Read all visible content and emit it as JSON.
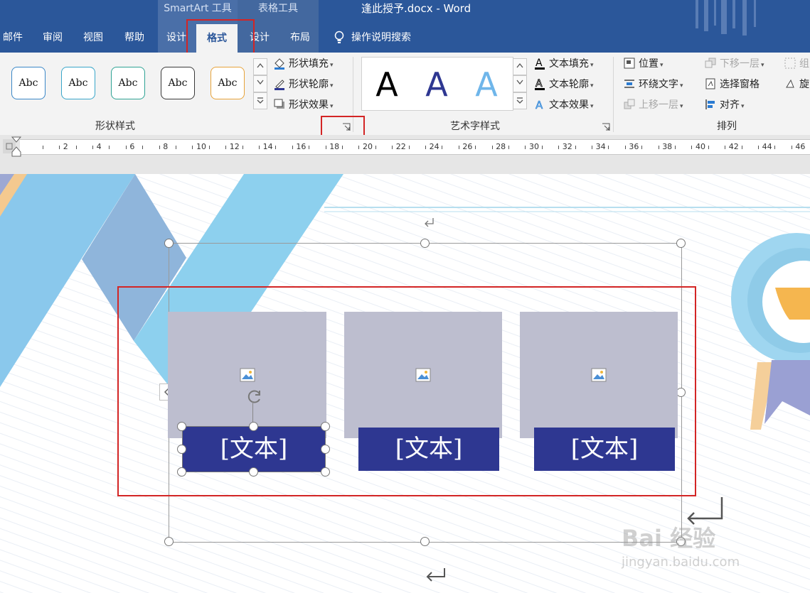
{
  "window": {
    "title": "逢此授予.docx  -  Word",
    "context_groups": [
      "SmartArt 工具",
      "表格工具"
    ]
  },
  "tabs": [
    {
      "label": "邮件"
    },
    {
      "label": "审阅"
    },
    {
      "label": "视图"
    },
    {
      "label": "帮助"
    },
    {
      "label": "设计"
    },
    {
      "label": "格式",
      "active": true
    },
    {
      "label": "设计"
    },
    {
      "label": "布局"
    }
  ],
  "tell_me": "操作说明搜索",
  "ribbon": {
    "shape_styles": {
      "presets": [
        "Abc",
        "Abc",
        "Abc",
        "Abc",
        "Abc"
      ],
      "preset_colors": [
        "#3a87c7",
        "#39a6c9",
        "#2fa394",
        "#3a3a3a",
        "#e7a33a"
      ],
      "fill": "形状填充",
      "outline": "形状轮廓",
      "effects": "形状效果",
      "label": "形状样式"
    },
    "wordart_styles": {
      "presets": [
        "A",
        "A",
        "A"
      ],
      "fill": "文本填充",
      "outline": "文本轮廓",
      "effects": "文本效果",
      "label": "艺术字样式"
    },
    "arrange": {
      "position": "位置",
      "wrap_text": "环绕文字",
      "bring_forward": "上移一层",
      "send_backward": "下移一层",
      "selection_pane": "选择窗格",
      "align": "对齐",
      "group": "组",
      "rotate": "旋",
      "label": "排列"
    }
  },
  "ruler": {
    "numbers": [
      "2",
      "4",
      "6",
      "8",
      "10",
      "12",
      "14",
      "16",
      "18",
      "20",
      "22",
      "24",
      "26",
      "28",
      "30",
      "32",
      "34",
      "36",
      "38",
      "40",
      "42",
      "44",
      "46"
    ]
  },
  "document": {
    "smartart_items": [
      {
        "text": "[文本]"
      },
      {
        "text": "[文本]"
      },
      {
        "text": "[文本]"
      }
    ],
    "colors": {
      "tile": "#bdbecf",
      "text_box": "#2e3791",
      "highlight": "#d32525"
    }
  },
  "watermark": {
    "brand": "Bai  经验",
    "url": "jingyan.baidu.com"
  }
}
